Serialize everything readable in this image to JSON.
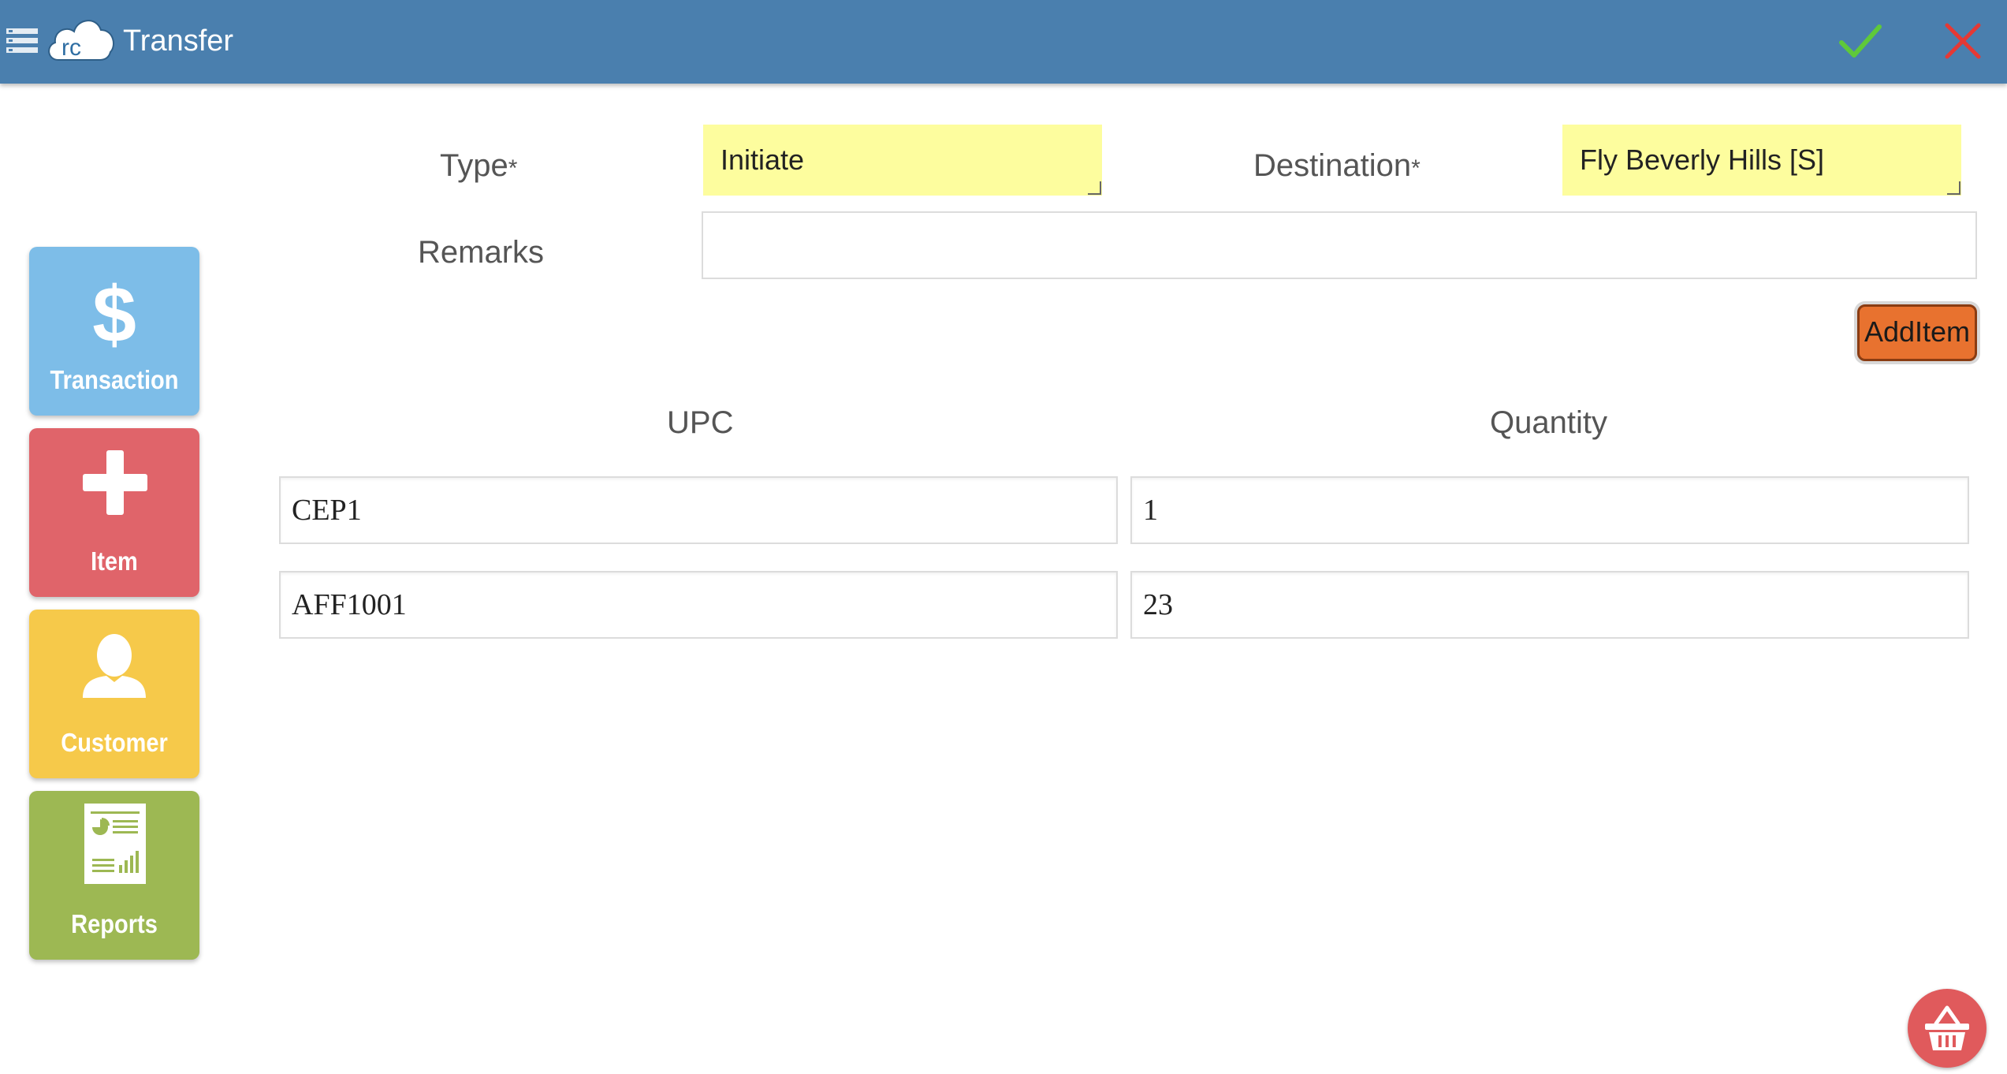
{
  "colors": {
    "topbar": "#4a7fae",
    "confirm": "#5fc93a",
    "cancel": "#e53935",
    "highlight_field": "#fdfd9e",
    "add_item_button": "#e8722f",
    "tile_transaction": "#7dbde8",
    "tile_item": "#e0646a",
    "tile_customer": "#f6c94a",
    "tile_reports": "#9db853",
    "basket_button": "#e05a5c"
  },
  "header": {
    "logo_text": "rc",
    "title": "Transfer"
  },
  "sidebar": {
    "tiles": [
      {
        "label": "Transaction",
        "icon": "dollar-icon"
      },
      {
        "label": "Item",
        "icon": "plus-icon"
      },
      {
        "label": "Customer",
        "icon": "person-icon"
      },
      {
        "label": "Reports",
        "icon": "report-icon"
      }
    ]
  },
  "form": {
    "type_label": "Type",
    "type_value": "Initiate",
    "destination_label": "Destination",
    "destination_value": "Fly Beverly Hills [S]",
    "required_mark": "*",
    "remarks_label": "Remarks",
    "remarks_value": "",
    "add_item_label": "AddItem"
  },
  "items": {
    "upc_header": "UPC",
    "quantity_header": "Quantity",
    "rows": [
      {
        "upc": "CEP1",
        "quantity": "1"
      },
      {
        "upc": "AFF1001",
        "quantity": "23"
      }
    ]
  }
}
